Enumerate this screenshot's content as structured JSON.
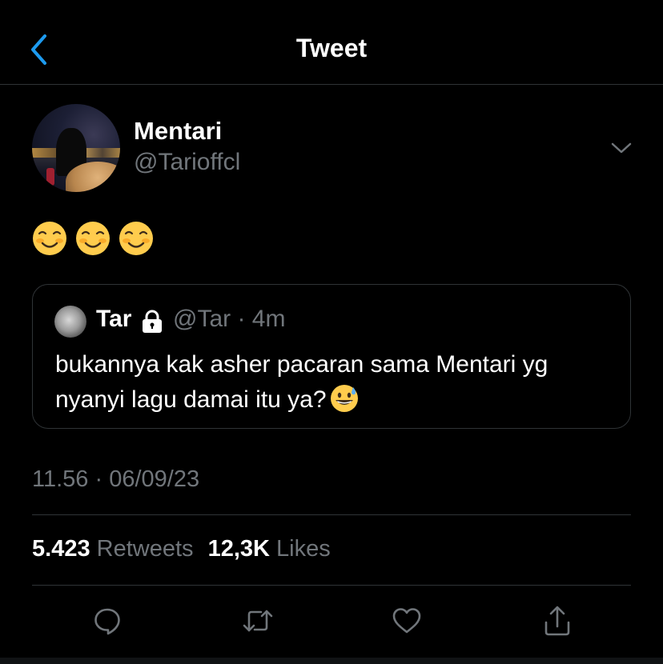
{
  "header": {
    "title": "Tweet"
  },
  "tweet": {
    "author": {
      "display_name": "Mentari",
      "handle": "@Tarioffcl"
    },
    "body_emoji": [
      "smiling-face-icon",
      "smiling-face-icon",
      "smiling-face-icon"
    ],
    "quoted": {
      "author_name": "Tar",
      "handle_time": "@Tar · 4m",
      "text": "bukannya kak asher pacaran sama Mentari yg nyanyi lagu damai itu ya?",
      "trailing_emoji": "grinning-sweat-icon"
    },
    "timestamp": "11.56 · 06/09/23",
    "stats": {
      "retweets_count": "5.423",
      "retweets_label": "Retweets",
      "likes_count": "12,3K",
      "likes_label": "Likes"
    }
  },
  "actions": [
    "reply-icon",
    "retweet-icon",
    "like-icon",
    "share-icon"
  ],
  "colors": {
    "background": "#000000",
    "accent": "#1d9bf0",
    "secondary_text": "#71767b",
    "divider": "#2f3336"
  }
}
